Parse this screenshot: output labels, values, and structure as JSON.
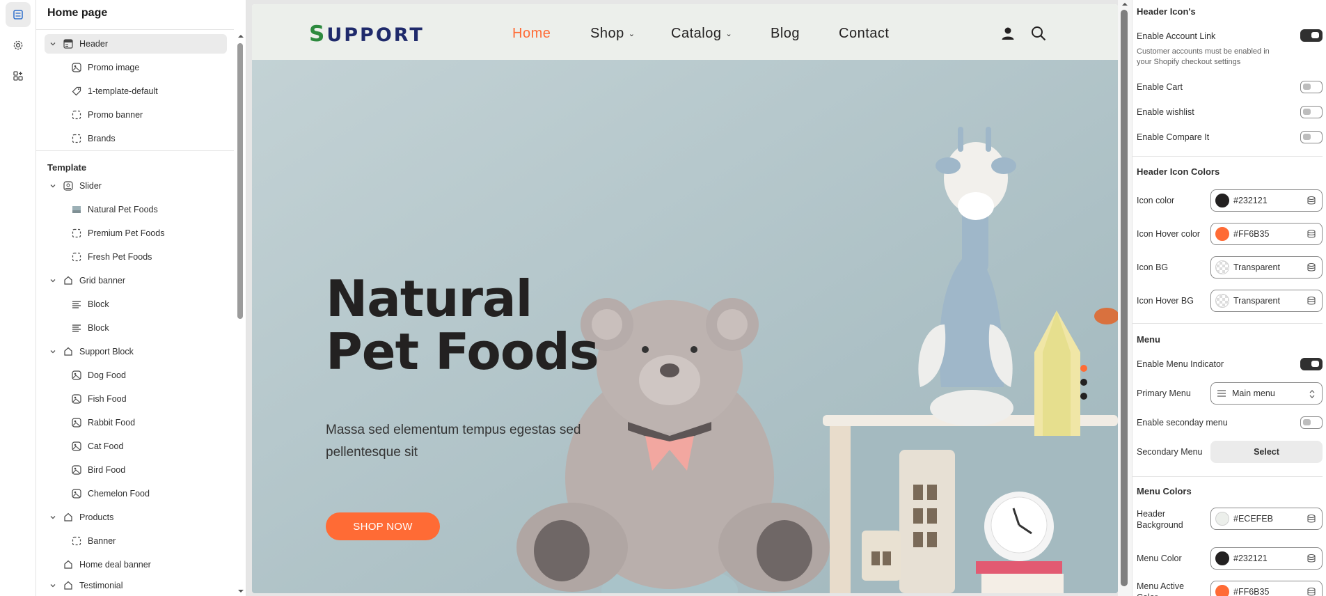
{
  "sidebar": {
    "title": "Home page",
    "header_group": [
      {
        "label": "Header",
        "icon": "header-layout-icon"
      },
      {
        "label": "Promo image",
        "icon": "image-icon"
      },
      {
        "label": "1-template-default",
        "icon": "tag-icon"
      },
      {
        "label": "Promo banner",
        "icon": "dashed-square-icon"
      },
      {
        "label": "Brands",
        "icon": "dashed-square-icon"
      }
    ],
    "template_label": "Template",
    "template_items": [
      {
        "label": "Slider",
        "icon": "slider-icon",
        "level": 1
      },
      {
        "label": "Natural Pet Foods",
        "icon": "image-thumb-icon",
        "level": 2
      },
      {
        "label": "Premium Pet Foods",
        "icon": "dashed-square-icon",
        "level": 2
      },
      {
        "label": "Fresh Pet Foods",
        "icon": "dashed-square-icon",
        "level": 2
      },
      {
        "label": "Grid banner",
        "icon": "section-icon",
        "level": 1
      },
      {
        "label": "Block",
        "icon": "text-icon",
        "level": 2
      },
      {
        "label": "Block",
        "icon": "text-icon",
        "level": 2
      },
      {
        "label": "Support Block",
        "icon": "section-icon",
        "level": 1
      },
      {
        "label": "Dog Food",
        "icon": "image-icon",
        "level": 2
      },
      {
        "label": "Fish Food",
        "icon": "image-icon",
        "level": 2
      },
      {
        "label": "Rabbit Food",
        "icon": "image-icon",
        "level": 2
      },
      {
        "label": "Cat Food",
        "icon": "image-icon",
        "level": 2
      },
      {
        "label": "Bird Food",
        "icon": "image-icon",
        "level": 2
      },
      {
        "label": "Chemelon Food",
        "icon": "image-icon",
        "level": 2
      },
      {
        "label": "Products",
        "icon": "section-icon",
        "level": 1
      },
      {
        "label": "Banner",
        "icon": "dashed-square-icon",
        "level": 2
      },
      {
        "label": "Home deal banner",
        "icon": "section-icon",
        "level": 1
      },
      {
        "label": "Testimonial",
        "icon": "section-icon",
        "level": 1
      }
    ]
  },
  "preview": {
    "logo": {
      "first": "S",
      "rest": "UPPORT"
    },
    "nav": [
      "Home",
      "Shop",
      "Catalog",
      "Blog",
      "Contact"
    ],
    "hero": {
      "title_line1": "Natural",
      "title_line2": "Pet Foods",
      "subtitle": "Massa sed elementum tempus egestas sed pellentesque sit",
      "button": "SHOP NOW"
    }
  },
  "panel": {
    "header_icons_heading": "Header Icon's",
    "enable_account_link": "Enable Account Link",
    "account_help": "Customer accounts must be enabled in your Shopify checkout settings",
    "enable_cart": "Enable Cart",
    "enable_wishlist": "Enable wishlist",
    "enable_compare": "Enable Compare It",
    "header_icon_colors_heading": "Header Icon Colors",
    "icon_color_label": "Icon color",
    "icon_color_value": "#232121",
    "icon_hover_label": "Icon Hover color",
    "icon_hover_value": "#FF6B35",
    "icon_bg_label": "Icon BG",
    "icon_bg_value": "Transparent",
    "icon_hover_bg_label": "Icon Hover BG",
    "icon_hover_bg_value": "Transparent",
    "menu_heading": "Menu",
    "enable_menu_indicator": "Enable Menu Indicator",
    "primary_menu_label": "Primary Menu",
    "primary_menu_value": "Main menu",
    "enable_secondary": "Enable seconday menu",
    "secondary_menu_label": "Secondary Menu",
    "secondary_menu_button": "Select",
    "menu_colors_heading": "Menu Colors",
    "header_bg_label": "Header Background",
    "header_bg_value": "#ECEFEB",
    "menu_color_label": "Menu Color",
    "menu_color_value": "#232121",
    "menu_active_label": "Menu Active Color",
    "menu_active_value": "#FF6B35",
    "toggles": {
      "account": true,
      "cart": false,
      "wishlist": false,
      "compare": false,
      "menu_indicator": true,
      "secondary": false
    }
  },
  "colors": {
    "accent": "#ff6b35",
    "dark": "#232121",
    "header_bg": "#ecefeb",
    "brand_blue": "#1f2a6b",
    "brand_green": "#2d8a3e"
  }
}
